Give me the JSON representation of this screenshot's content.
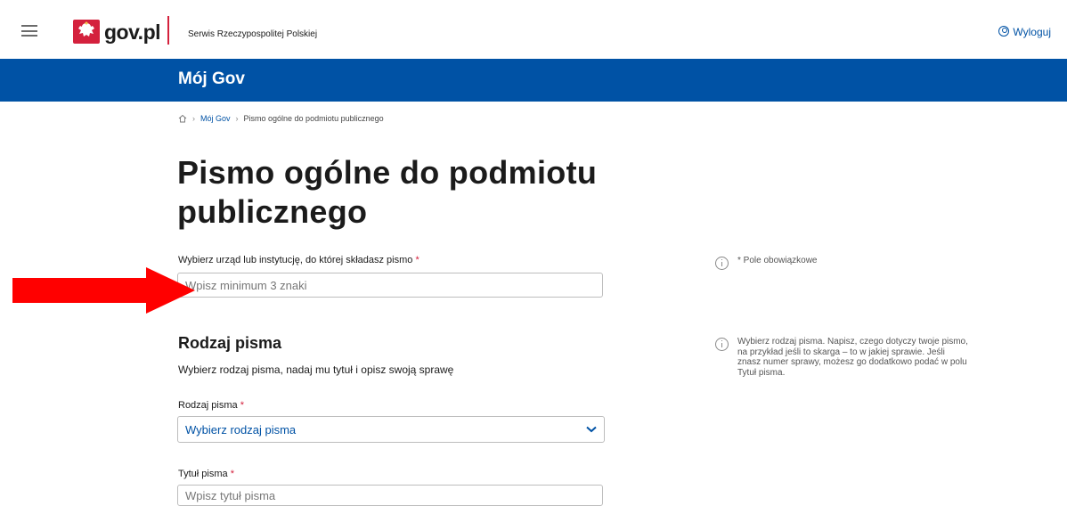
{
  "header": {
    "logo_text": "gov.pl",
    "service_name": "Serwis Rzeczypospolitej Polskiej",
    "logout_label": "Wyloguj"
  },
  "band": {
    "title": "Mój Gov"
  },
  "breadcrumb": {
    "items": [
      "Mój Gov",
      "Pismo ogólne do podmiotu publicznego"
    ]
  },
  "page": {
    "title": "Pismo ogólne do podmiotu publicznego"
  },
  "form": {
    "institution": {
      "label": "Wybierz urząd lub instytucję, do której składasz pismo",
      "required_mark": "*",
      "placeholder": "Wpisz minimum 3 znaki"
    },
    "section": {
      "title": "Rodzaj pisma",
      "description": "Wybierz rodzaj pisma, nadaj mu tytuł i opisz swoją sprawę"
    },
    "letter_type": {
      "label": "Rodzaj pisma",
      "required_mark": "*",
      "selected": "Wybierz rodzaj pisma"
    },
    "letter_title": {
      "label": "Tytuł pisma",
      "required_mark": "*",
      "placeholder": "Wpisz tytuł pisma"
    }
  },
  "notes": {
    "required_fields": "* Pole obowiązkowe",
    "letter_type_hint": "Wybierz rodzaj pisma. Napisz, czego dotyczy twoje pismo, na przykład jeśli to skarga – to w jakiej sprawie. Jeśli znasz numer sprawy, możesz go dodatkowo podać w polu Tytuł pisma."
  },
  "colors": {
    "brand_blue": "#0052a5",
    "brand_red": "#d4213d",
    "arrow_red": "#ff0000"
  },
  "icons": [
    "hamburger-menu-icon",
    "poland-emblem-icon",
    "user-logout-icon",
    "home-icon",
    "chevron-right-icon",
    "info-icon",
    "chevron-down-icon",
    "red-arrow-annotation"
  ]
}
